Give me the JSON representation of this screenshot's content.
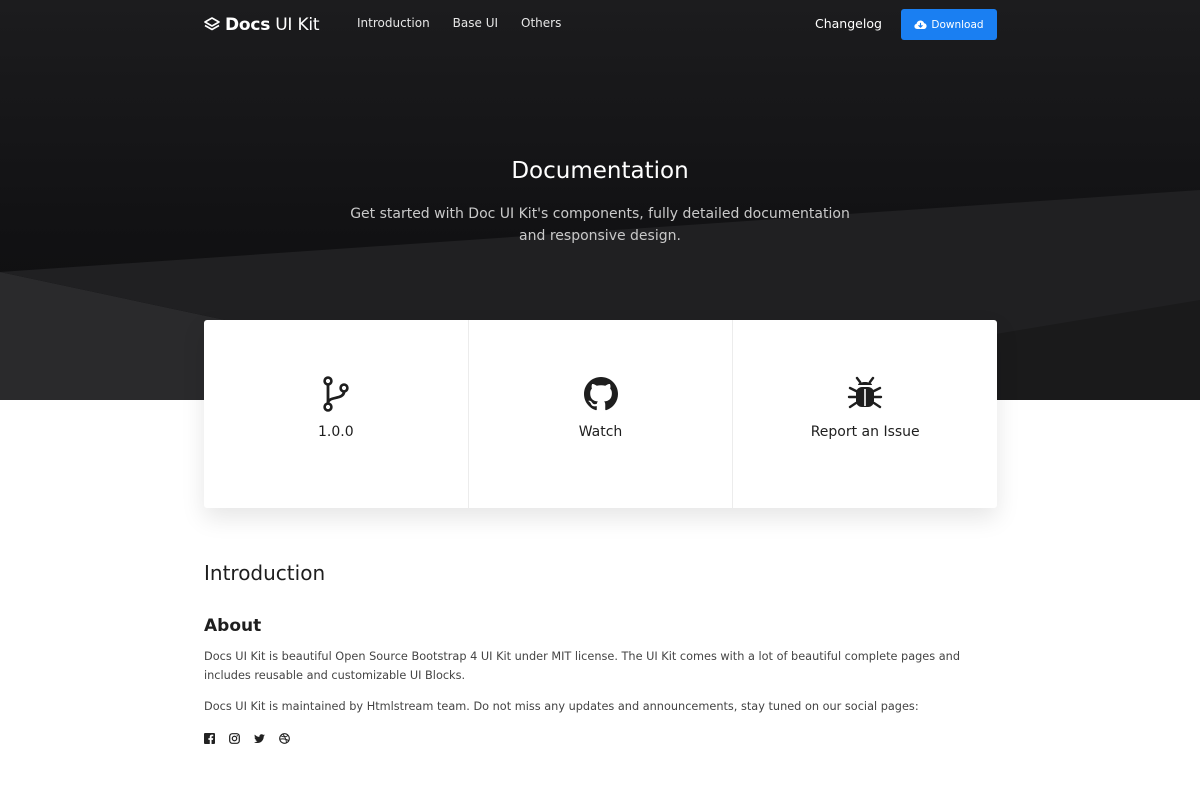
{
  "nav": {
    "brand_bold": "Docs",
    "brand_light": "UI Kit",
    "links": [
      "Introduction",
      "Base UI",
      "Others"
    ],
    "changelog": "Changelog",
    "download": "Download"
  },
  "hero": {
    "title": "Documentation",
    "subtitle": "Get started with Doc UI Kit's components, fully detailed documentation and responsive design."
  },
  "cards": [
    {
      "icon": "git-branch-icon",
      "label": "1.0.0"
    },
    {
      "icon": "github-icon",
      "label": "Watch"
    },
    {
      "icon": "bug-icon",
      "label": "Report an Issue"
    }
  ],
  "intro": {
    "title": "Introduction",
    "about_title": "About",
    "para1": "Docs UI Kit is beautiful Open Source Bootstrap 4 UI Kit under MIT license. The UI Kit comes with a lot of beautiful complete pages and includes reusable and customizable UI Blocks.",
    "para2": "Docs UI Kit is maintained by Htmlstream team. Do not miss any updates and announcements, stay tuned on our social pages:",
    "social": [
      "facebook-icon",
      "instagram-icon",
      "twitter-icon",
      "dribbble-icon"
    ]
  },
  "colors": {
    "primary": "#1a7ff2",
    "hero_bg": "#111113",
    "text": "#1e1e1e"
  }
}
